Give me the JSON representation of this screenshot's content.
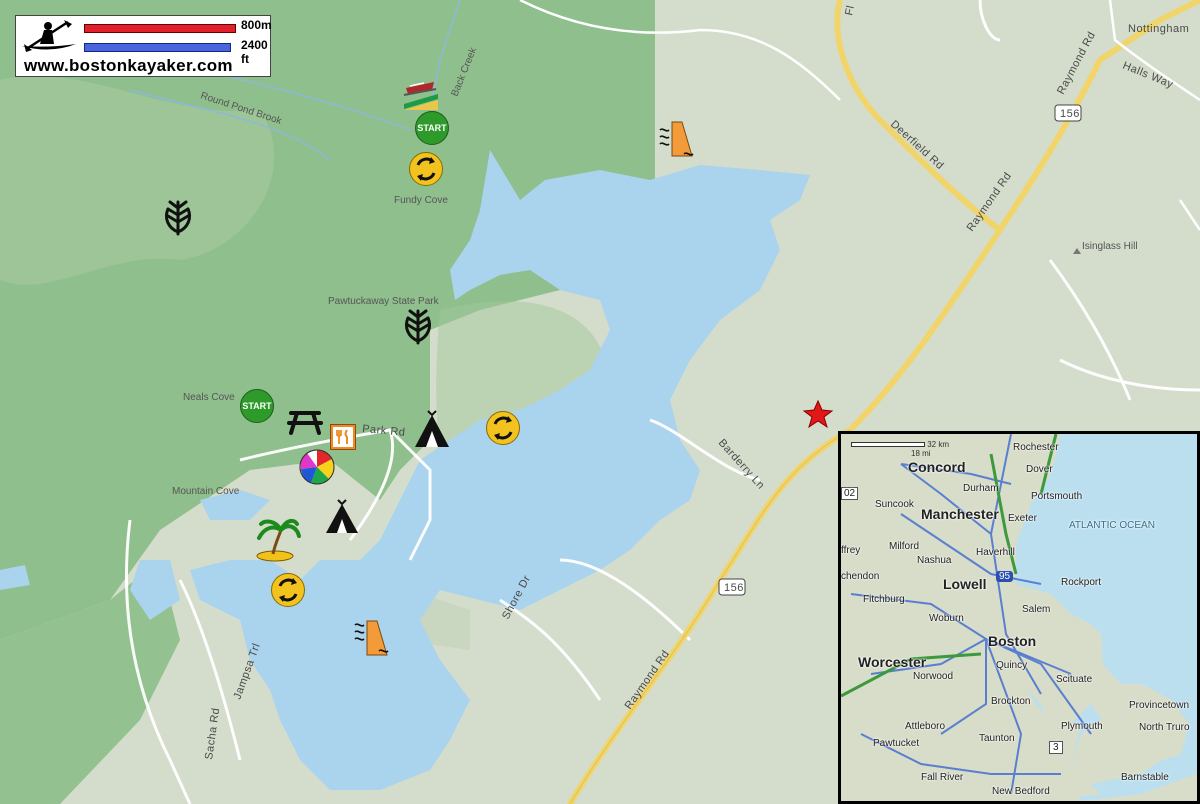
{
  "logo": {
    "site": "www.bostonkayaker.com",
    "scale_metric": "800m",
    "scale_imperial": "2400 ft",
    "metric_color": "#e0202a",
    "imperial_color": "#4a64e0"
  },
  "map_labels": {
    "round_pond_brook": "Round Pond Brook",
    "back_creek": "Back Creek",
    "fundy_cove": "Fundy Cove",
    "pawtuckaway_state_park": "Pawtuckaway State Park",
    "neals_cove": "Neals Cove",
    "mountain_cove": "Mountain Cove",
    "park_rd": "Park Rd",
    "barderry_ln": "Barderry Ln",
    "shore_dr": "Shore Dr",
    "raymond_rd_bottom": "Raymond Rd",
    "raymond_rd_right": "Raymond Rd",
    "raymond_rd_top": "Raymond Rd",
    "deerfield_rd": "Deerfield Rd",
    "halls_way": "Halls Way",
    "nottingham": "Nottingham",
    "isinglass_hill": "Isinglass Hill",
    "jampsa_trl": "Jampsa Trl",
    "sacha_rd": "Sacha Rd",
    "route_156_top": "156",
    "route_156_bottom": "156",
    "fl_partial": "Fl"
  },
  "icons": [
    {
      "name": "boat-launch-icon"
    },
    {
      "name": "start-icon",
      "label": "START"
    },
    {
      "name": "start-icon",
      "label": "START"
    },
    {
      "name": "kayak-loop-icon"
    },
    {
      "name": "forest-icon"
    },
    {
      "name": "dam-icon"
    },
    {
      "name": "picnic-table-icon"
    },
    {
      "name": "restaurant-icon"
    },
    {
      "name": "camping-icon"
    },
    {
      "name": "beach-ball-icon"
    },
    {
      "name": "palm-island-icon"
    },
    {
      "name": "star-marker-icon"
    }
  ],
  "inset": {
    "scale_km": "32 km",
    "scale_mi": "18 mi",
    "cities": {
      "concord": "Concord",
      "rochester": "Rochester",
      "dover": "Dover",
      "durham": "Durham",
      "portsmouth": "Portsmouth",
      "suncook": "Suncook",
      "manchester": "Manchester",
      "exeter": "Exeter",
      "milford": "Milford",
      "nashua": "Nashua",
      "haverhill": "Haverhill",
      "ffrey": "ffrey",
      "chendon": "chendon",
      "lowell": "Lowell",
      "rockport": "Rockport",
      "fitchburg": "Fitchburg",
      "salem": "Salem",
      "woburn": "Woburn",
      "boston": "Boston",
      "worcester": "Worcester",
      "quincy": "Quincy",
      "norwood": "Norwood",
      "scituate": "Scituate",
      "brockton": "Brockton",
      "provincetown": "Provincetown",
      "north_truro": "North Truro",
      "attleboro": "Attleboro",
      "plymouth": "Plymouth",
      "pawtucket": "Pawtucket",
      "taunton": "Taunton",
      "fall_river": "Fall River",
      "new_bedford": "New Bedford",
      "barnstable": "Barnstable",
      "ocean": "ATLANTIC OCEAN",
      "i95": "95",
      "rt3": "3",
      "rt202": "02"
    }
  },
  "colors": {
    "water": "#aad3ee",
    "forest": "#8fbf8c",
    "land": "#d9dfd2",
    "road_yellow": "#f6d96b"
  }
}
